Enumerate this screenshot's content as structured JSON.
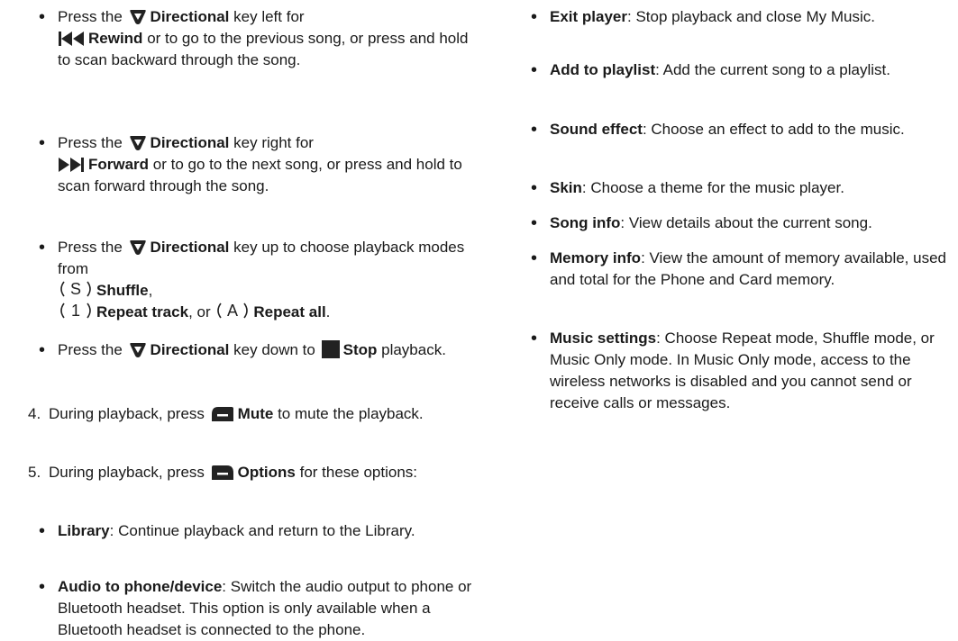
{
  "left": {
    "bullet1": {
      "pre": "Press the",
      "key": "Directional",
      "mid": "key left for",
      "cmd": "Rewind",
      "post": "or to go to the previous song, or press and hold to scan backward through the song."
    },
    "bullet2": {
      "pre": "Press the",
      "key": "Directional",
      "mid": "key right for",
      "cmd": "Forward",
      "post": "or to go to the next song, or press and hold to scan forward through the song."
    },
    "bullet3": {
      "pre": "Press the",
      "key": "Directional",
      "mid": "key up to choose playback modes from",
      "shuffle": "Shuffle",
      "sep1": ",",
      "repeat_track": "Repeat track",
      "sep2": ", or",
      "repeat_all": "Repeat all",
      "end": "."
    },
    "bullet4": {
      "pre": "Press the",
      "key": "Directional",
      "mid": "key down to",
      "cmd": "Stop",
      "post": "playback."
    },
    "step4": {
      "num": "4.",
      "pre": "During playback, press",
      "key": "Mute",
      "post": "to mute the playback."
    },
    "step5": {
      "num": "5.",
      "pre": "During playback, press",
      "key": "Options",
      "post": "for these options:"
    },
    "options": [
      {
        "term": "Library",
        "desc": ": Continue playback and return to the Library."
      },
      {
        "term": "Audio to phone/device",
        "desc": ": Switch the audio output to phone or Bluetooth headset. This option is only available when a Bluetooth headset is connected to the phone."
      }
    ]
  },
  "right": {
    "options": [
      {
        "term": "Exit player",
        "desc": ": Stop playback and close My Music."
      },
      {
        "term": "Add to playlist",
        "desc": ": Add the current song to a playlist."
      },
      {
        "term": "Sound effect",
        "desc": ": Choose an effect to add to the music."
      },
      {
        "term": "Skin",
        "desc": ": Choose a theme for the music player."
      },
      {
        "term": "Song info",
        "desc": ": View details about the current song."
      },
      {
        "term": "Memory info",
        "desc": ": View the amount of memory available, used and total for the Phone and Card memory."
      },
      {
        "term": "Music settings",
        "desc": ": Choose Repeat mode, Shuffle mode, or Music Only mode. In Music Only mode, access to the wireless networks is disabled and you cannot send or receive calls or messages."
      }
    ]
  },
  "icons": {
    "directional": "directional-key-icon",
    "rewind": "rewind-icon",
    "forward": "forward-icon",
    "shuffle": "shuffle-mode-icon",
    "repeat_track": "repeat-track-icon",
    "repeat_all": "repeat-all-icon",
    "stop": "stop-icon",
    "mute": "left-softkey-icon",
    "options": "right-softkey-icon"
  },
  "icon_glyphs": {
    "shuffle": "S",
    "repeat_track": "1",
    "repeat_all": "A"
  },
  "colors": {
    "text": "#1a1a1a",
    "key_icon": "#222222"
  }
}
